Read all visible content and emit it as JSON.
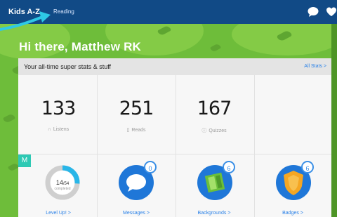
{
  "topbar": {
    "brand": "Kids A-Z",
    "nav_reading": "Reading"
  },
  "greeting": "Hi there, Matthew RK",
  "stats_card": {
    "title": "Your all-time super stats & stuff",
    "all_stats": "All Stats >",
    "stats": [
      {
        "value": "133",
        "label": "Listens",
        "icon": "headphones-icon"
      },
      {
        "value": "251",
        "label": "Reads",
        "icon": "book-icon"
      },
      {
        "value": "167",
        "label": "Quizzes",
        "icon": "question-icon"
      }
    ],
    "m_badge": "M",
    "progress": {
      "current": "14",
      "total": "54",
      "sub": "completed",
      "fraction": 0.26
    },
    "tiles": [
      {
        "label": "Level Up! >"
      },
      {
        "label": "Messages >",
        "count": "0"
      },
      {
        "label": "Backgrounds >",
        "count": "6"
      },
      {
        "label": "Badges >",
        "count": "6"
      }
    ]
  },
  "colors": {
    "topbar": "#114a86",
    "accent": "#2b82e8",
    "green": "#6ebd3a",
    "teal": "#2ec9b4"
  }
}
